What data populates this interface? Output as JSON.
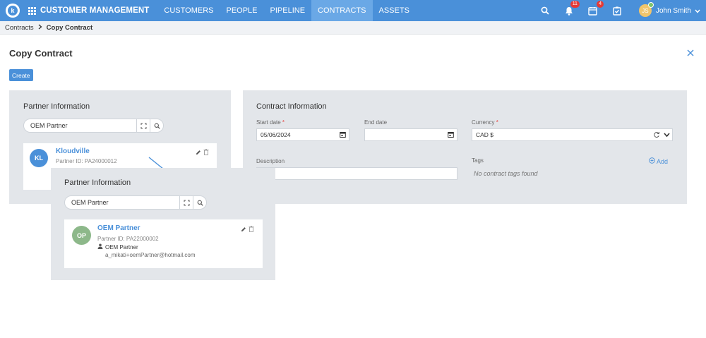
{
  "nav": {
    "logo_letter": "k",
    "app_title": "CUSTOMER MANAGEMENT",
    "items": [
      {
        "label": "CUSTOMERS"
      },
      {
        "label": "PEOPLE"
      },
      {
        "label": "PIPELINE"
      },
      {
        "label": "CONTRACTS"
      },
      {
        "label": "ASSETS"
      }
    ],
    "notifications_count": "11",
    "tasks_count": "4",
    "user_initials": "JS",
    "user_name": "John Smith",
    "accent_color": "#4a90d9",
    "icons": [
      "search-icon",
      "bell-icon",
      "calendar-icon",
      "checklist-icon",
      "chevron-down-icon"
    ]
  },
  "breadcrumb": {
    "parent": "Contracts",
    "current": "Copy Contract"
  },
  "page": {
    "title": "Copy Contract",
    "create_label": "Create"
  },
  "partner_panel": {
    "title": "Partner Information",
    "search_value": "OEM Partner",
    "card": {
      "initials": "KL",
      "name": "Kloudville",
      "partner_id": "Partner ID: PA24000012"
    }
  },
  "contract_panel": {
    "title": "Contract Information",
    "start_date_label": "Start date",
    "start_date_value": "05/06/2024",
    "end_date_label": "End date",
    "end_date_value": "",
    "currency_label": "Currency",
    "currency_value": "CAD $",
    "description_label": "Description",
    "tags_label": "Tags",
    "tags_empty": "No contract tags found",
    "add_label": "Add"
  },
  "zoom_panel": {
    "title": "Partner Information",
    "search_value": "OEM Partner",
    "card": {
      "initials": "OP",
      "name": "OEM Partner",
      "partner_id": "Partner ID: PA22000002",
      "contact_name": "OEM Partner",
      "contact_email": "a_mikati+oemPartner@hotmail.com"
    }
  }
}
